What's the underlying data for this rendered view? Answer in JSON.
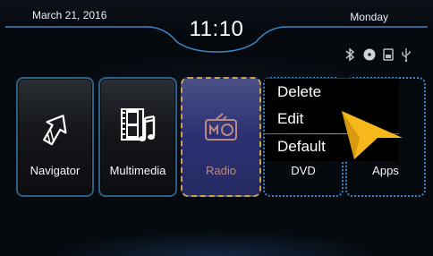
{
  "status_bar": {
    "date": "March 21, 2016",
    "time": "11:10",
    "day": "Monday",
    "icons": [
      "bluetooth-icon",
      "disc-icon",
      "sd-card-icon",
      "usb-icon"
    ]
  },
  "home_tiles": [
    {
      "id": "navigator",
      "label": "Navigator",
      "icon": "navigation-arrow-icon"
    },
    {
      "id": "multimedia",
      "label": "Multimedia",
      "icon": "film-music-icon"
    },
    {
      "id": "radio",
      "label": "Radio",
      "icon": "radio-icon",
      "selected": true
    },
    {
      "id": "dvd",
      "label": "DVD"
    },
    {
      "id": "apps",
      "label": "Apps"
    }
  ],
  "context_menu": {
    "items": [
      {
        "label": "Delete"
      },
      {
        "label": "Edit"
      },
      {
        "label": "Default"
      }
    ]
  },
  "pointer": {
    "icon": "pointer-arrow-icon",
    "color": "#f6b81a"
  },
  "colors": {
    "tile_border": "#2d5f86",
    "selected_tile": "#2c3072",
    "selected_border": "#c9a24a",
    "dotted_border": "#3d86c8"
  }
}
